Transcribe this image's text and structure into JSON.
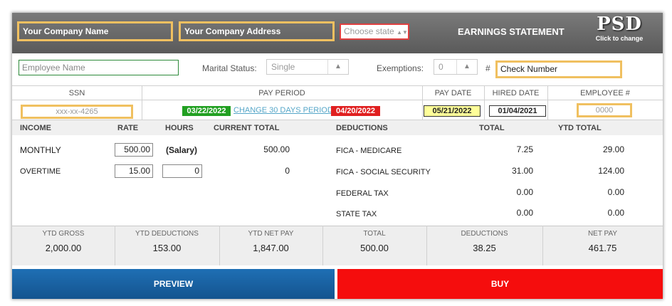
{
  "header": {
    "company_name": "Your Company Name",
    "company_address": "Your Company Address",
    "state_placeholder": "Choose state",
    "title": "EARNINGS STATEMENT",
    "logo": "PSD",
    "logo_caption": "Click to change"
  },
  "employee_row": {
    "employee_name_placeholder": "Employee Name",
    "marital_label": "Marital Status:",
    "marital_value": "Single",
    "exemptions_label": "Exemptions:",
    "exemptions_value": "0",
    "hash": "#",
    "check_number": "Check Number"
  },
  "info_headers": {
    "ssn": "SSN",
    "pay_period": "PAY PERIOD",
    "pay_date": "PAY DATE",
    "hired_date": "HIRED DATE",
    "employee_no": "EMPLOYEE #"
  },
  "info_values": {
    "ssn": "xxx-xx-4265",
    "period_start": "03/22/2022",
    "change_period_link": "CHANGE 30 DAYS PERIOD",
    "period_end": "04/20/2022",
    "pay_date": "05/21/2022",
    "hired_date": "01/04/2021",
    "employee_no": "0000"
  },
  "income": {
    "headers": {
      "income": "INCOME",
      "rate": "RATE",
      "hours": "HOURS",
      "current_total": "CURRENT TOTAL"
    },
    "rows": [
      {
        "label": "MONTHLY",
        "rate": "500.00",
        "hours": "(Salary)",
        "total": "500.00"
      },
      {
        "label": "OVERTIME",
        "rate": "15.00",
        "hours": "0",
        "total": "0"
      }
    ]
  },
  "deductions": {
    "headers": {
      "deductions": "DEDUCTIONS",
      "total": "TOTAL",
      "ytd_total": "YTD TOTAL"
    },
    "rows": [
      {
        "label": "FICA - MEDICARE",
        "total": "7.25",
        "ytd": "29.00"
      },
      {
        "label": "FICA - SOCIAL SECURITY",
        "total": "31.00",
        "ytd": "124.00"
      },
      {
        "label": "FEDERAL TAX",
        "total": "0.00",
        "ytd": "0.00"
      },
      {
        "label": "STATE TAX",
        "total": "0.00",
        "ytd": "0.00"
      }
    ]
  },
  "summary": [
    {
      "label": "YTD GROSS",
      "value": "2,000.00"
    },
    {
      "label": "YTD DEDUCTIONS",
      "value": "153.00"
    },
    {
      "label": "YTD NET PAY",
      "value": "1,847.00"
    },
    {
      "label": "TOTAL",
      "value": "500.00"
    },
    {
      "label": "DEDUCTIONS",
      "value": "38.25"
    },
    {
      "label": "NET PAY",
      "value": "461.75"
    }
  ],
  "buttons": {
    "preview": "PREVIEW",
    "buy": "BUY"
  },
  "colors": {
    "header_bg": "#6a6a6a",
    "preview_blue": "#1a64a6",
    "buy_red": "#f50d0d",
    "highlight_yellow": "#f0c060",
    "period_green": "#22a022",
    "period_red": "#e02020"
  }
}
